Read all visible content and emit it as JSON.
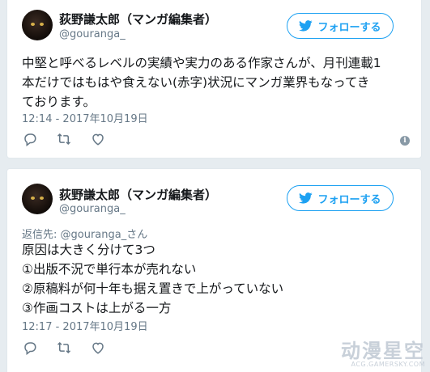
{
  "colors": {
    "accent": "#1da1f2",
    "muted": "#657786",
    "text": "#14171a",
    "page_bg": "#e6ecf0"
  },
  "tweets": [
    {
      "author": {
        "display_name": "荻野謙太郎（マンガ編集者）",
        "handle": "@gouranga_",
        "avatar_icon": "cat-avatar"
      },
      "follow_label": "フォローする",
      "reply_to": null,
      "lines": [
        "中堅と呼べるレベルの実績や実力のある作家さんが、月刊連載1",
        "本だけではもはや食えない(赤字)状況にマンガ業界もなってき",
        "ております。"
      ],
      "timestamp": "12:14 - 2017年10月19日",
      "actions": [
        "reply-icon",
        "retweet-icon",
        "like-icon"
      ],
      "info_icon": "i"
    },
    {
      "author": {
        "display_name": "荻野謙太郎（マンガ編集者）",
        "handle": "@gouranga_",
        "avatar_icon": "cat-avatar"
      },
      "follow_label": "フォローする",
      "reply_to": "返信先: @gouranga_さん",
      "lines": [
        "原因は大きく分けて3つ",
        "①出版不況で単行本が売れない",
        "②原稿料が何十年も据え置きで上がっていない",
        "③作画コストは上がる一方"
      ],
      "timestamp": "12:17 - 2017年10月19日",
      "actions": [
        "reply-icon",
        "retweet-icon",
        "like-icon"
      ],
      "info_icon": "i"
    }
  ],
  "watermark": {
    "main": "动漫星空",
    "sub": "ACG.GAMERSKY.COM"
  }
}
